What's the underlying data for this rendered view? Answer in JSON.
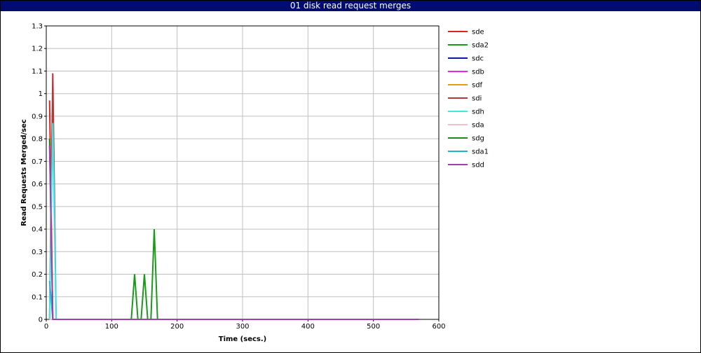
{
  "chart_data": {
    "type": "line",
    "title": "01 disk read request merges",
    "xlabel": "Time (secs.)",
    "ylabel": "Read Requests Merged/sec",
    "xlim": [
      0,
      600
    ],
    "ylim": [
      0,
      1.3
    ],
    "x_ticks": [
      "0",
      "100",
      "200",
      "300",
      "400",
      "500",
      "600"
    ],
    "y_ticks": [
      "0",
      "0.1",
      "0.2",
      "0.3",
      "0.4",
      "0.5",
      "0.6",
      "0.7",
      "0.8",
      "0.9",
      "1",
      "1.1",
      "1.2",
      "1.3"
    ],
    "grid": true,
    "legend_position": "right",
    "series": [
      {
        "name": "sde",
        "color": "#e8201b",
        "points": [
          [
            5,
            0.97
          ],
          [
            10,
            0.0
          ],
          [
            570,
            0.0
          ]
        ]
      },
      {
        "name": "sda2",
        "color": "#1a9a1a",
        "points": [
          [
            5,
            0.0
          ],
          [
            130,
            0.0
          ],
          [
            135,
            0.2
          ],
          [
            140,
            0.0
          ],
          [
            145,
            0.0
          ],
          [
            150,
            0.2
          ],
          [
            155,
            0.0
          ],
          [
            160,
            0.0
          ],
          [
            165,
            0.4
          ],
          [
            170,
            0.0
          ],
          [
            570,
            0.0
          ]
        ]
      },
      {
        "name": "sdc",
        "color": "#0a1aa6",
        "points": [
          [
            5,
            0.0
          ],
          [
            570,
            0.0
          ]
        ]
      },
      {
        "name": "sdb",
        "color": "#ee22ee",
        "points": [
          [
            5,
            0.0
          ],
          [
            570,
            0.0
          ]
        ]
      },
      {
        "name": "sdf",
        "color": "#e69a10",
        "points": [
          [
            5,
            0.0
          ],
          [
            570,
            0.0
          ]
        ]
      },
      {
        "name": "sdi",
        "color": "#b03a3a",
        "points": [
          [
            5,
            0.0
          ],
          [
            10,
            1.09
          ],
          [
            15,
            0.0
          ],
          [
            570,
            0.0
          ]
        ]
      },
      {
        "name": "sdh",
        "color": "#3ee8e8",
        "points": [
          [
            5,
            0.0
          ],
          [
            10,
            0.87
          ],
          [
            15,
            0.0
          ],
          [
            570,
            0.0
          ]
        ]
      },
      {
        "name": "sda",
        "color": "#f5c0c8",
        "points": [
          [
            5,
            0.0
          ],
          [
            570,
            0.0
          ]
        ]
      },
      {
        "name": "sdg",
        "color": "#1a8a1a",
        "points": [
          [
            5,
            0.8
          ],
          [
            10,
            0.0
          ],
          [
            570,
            0.0
          ]
        ]
      },
      {
        "name": "sda1",
        "color": "#18b8c8",
        "points": [
          [
            5,
            0.17
          ],
          [
            10,
            0.0
          ],
          [
            570,
            0.0
          ]
        ]
      },
      {
        "name": "sdd",
        "color": "#a040b0",
        "points": [
          [
            5,
            0.77
          ],
          [
            10,
            0.0
          ],
          [
            570,
            0.0
          ]
        ]
      }
    ]
  }
}
